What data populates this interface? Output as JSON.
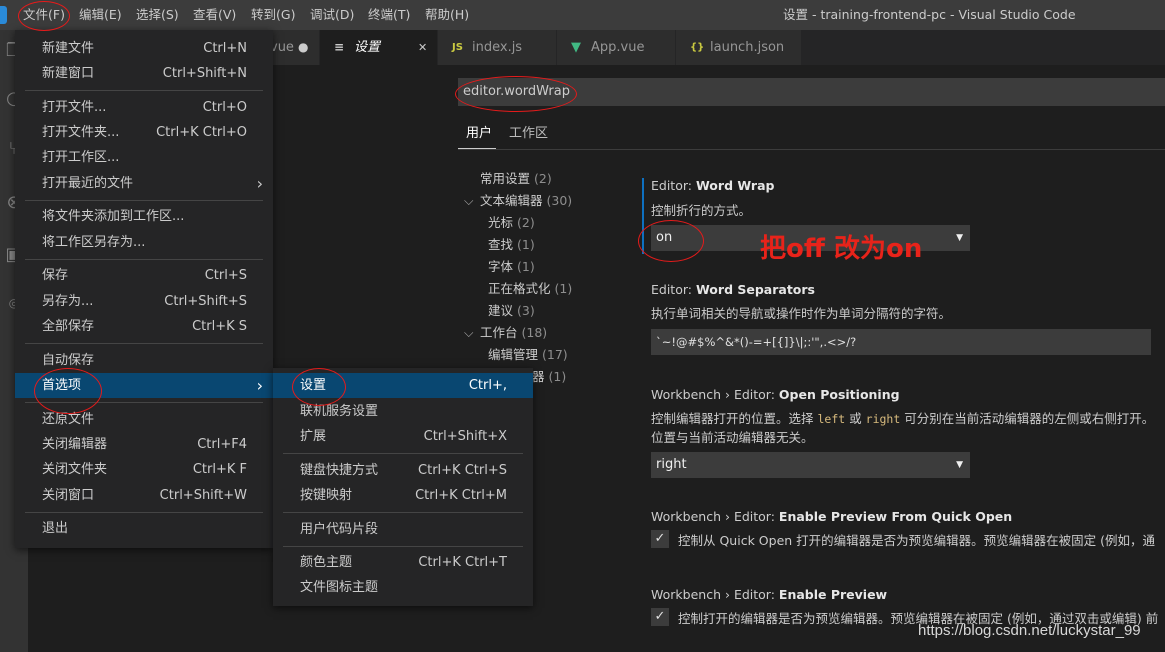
{
  "window_title": "设置 - training-frontend-pc - Visual Studio Code",
  "menubar": [
    "文件(F)",
    "编辑(E)",
    "选择(S)",
    "查看(V)",
    "转到(G)",
    "调试(D)",
    "终端(T)",
    "帮助(H)"
  ],
  "tabs": [
    {
      "label": "vue",
      "icon": "vue-icon",
      "dirty": true
    },
    {
      "label": "设置",
      "icon": "settings-file-icon",
      "close": "✕"
    },
    {
      "label": "index.js",
      "icon": "js-icon",
      "icon_text": "JS"
    },
    {
      "label": "App.vue",
      "icon": "vue-icon"
    },
    {
      "label": "launch.json",
      "icon": "json-icon",
      "icon_text": "{}"
    }
  ],
  "search_value": "editor.wordWrap",
  "scope_tabs": [
    "用户",
    "工作区"
  ],
  "toc": [
    {
      "label": "常用设置",
      "count": "(2)"
    },
    {
      "label": "文本编辑器",
      "count": "(30)",
      "expand": "⌵"
    },
    {
      "label": "光标",
      "count": "(2)"
    },
    {
      "label": "查找",
      "count": "(1)"
    },
    {
      "label": "字体",
      "count": "(1)"
    },
    {
      "label": "正在格式化",
      "count": "(1)"
    },
    {
      "label": "建议",
      "count": "(3)"
    },
    {
      "label": "工作台",
      "count": "(18)",
      "expand": "⌵"
    },
    {
      "label": "编辑管理",
      "count": "(17)"
    },
    {
      "label": "器",
      "count": "(1)"
    }
  ],
  "settings": {
    "word_wrap": {
      "prefix": "Editor: ",
      "name": "Word Wrap",
      "desc": "控制折行的方式。",
      "value": "on"
    },
    "word_separators": {
      "prefix": "Editor: ",
      "name": "Word Separators",
      "desc": "执行单词相关的导航或操作时作为单词分隔符的字符。",
      "value": "`~!@#$%^&*()-=+[{]}\\|;:'\",.<>/?"
    },
    "open_positioning": {
      "prefix": "Workbench › Editor: ",
      "name": "Open Positioning",
      "desc_1a": "控制编辑器打开的位置。选择 ",
      "code_left": "left",
      "desc_1b": " 或 ",
      "code_right": "right",
      "desc_1c": " 可分别在当前活动编辑器的左侧或右侧打开。",
      "desc_2": "位置与当前活动编辑器无关。",
      "value": "right"
    },
    "preview_quick_open": {
      "prefix": "Workbench › Editor: ",
      "name": "Enable Preview From Quick Open",
      "desc": "控制从 Quick Open 打开的编辑器是否为预览编辑器。预览编辑器在被固定 (例如，通"
    },
    "enable_preview": {
      "prefix": "Workbench › Editor: ",
      "name": "Enable Preview",
      "desc": "控制打开的编辑器是否为预览编辑器。预览编辑器在被固定 (例如，通过双击或编辑) 前"
    }
  },
  "file_menu": [
    {
      "label": "新建文件",
      "key": "Ctrl+N"
    },
    {
      "label": "新建窗口",
      "key": "Ctrl+Shift+N"
    },
    {
      "label": "打开文件...",
      "key": "Ctrl+O"
    },
    {
      "label": "打开文件夹...",
      "key": "Ctrl+K Ctrl+O"
    },
    {
      "label": "打开工作区...",
      "key": ""
    },
    {
      "label": "打开最近的文件",
      "key": "",
      "submenu": "›"
    },
    {
      "label": "将文件夹添加到工作区...",
      "key": ""
    },
    {
      "label": "将工作区另存为...",
      "key": ""
    },
    {
      "label": "保存",
      "key": "Ctrl+S"
    },
    {
      "label": "另存为...",
      "key": "Ctrl+Shift+S"
    },
    {
      "label": "全部保存",
      "key": "Ctrl+K S"
    },
    {
      "label": "自动保存",
      "key": ""
    },
    {
      "label": "首选项",
      "key": "",
      "submenu": "›"
    },
    {
      "label": "还原文件",
      "key": ""
    },
    {
      "label": "关闭编辑器",
      "key": "Ctrl+F4"
    },
    {
      "label": "关闭文件夹",
      "key": "Ctrl+K F"
    },
    {
      "label": "关闭窗口",
      "key": "Ctrl+Shift+W"
    },
    {
      "label": "退出",
      "key": ""
    }
  ],
  "prefs_menu": [
    {
      "label": "设置",
      "key": "Ctrl+,"
    },
    {
      "label": "联机服务设置",
      "key": ""
    },
    {
      "label": "扩展",
      "key": "Ctrl+Shift+X"
    },
    {
      "label": "键盘快捷方式",
      "key": "Ctrl+K Ctrl+S"
    },
    {
      "label": "按键映射",
      "key": "Ctrl+K Ctrl+M"
    },
    {
      "label": "用户代码片段",
      "key": ""
    },
    {
      "label": "颜色主题",
      "key": "Ctrl+K Ctrl+T"
    },
    {
      "label": "文件图标主题",
      "key": ""
    }
  ],
  "annotation": "把off 改为on",
  "watermark": "https://blog.csdn.net/luckystar_99",
  "colors": {
    "accent": "#094771",
    "annotation": "#e8231a",
    "vue": "#41b883",
    "js": "#cbcb41",
    "json": "#cbcb41",
    "setting_bar": "#0e70c0"
  }
}
